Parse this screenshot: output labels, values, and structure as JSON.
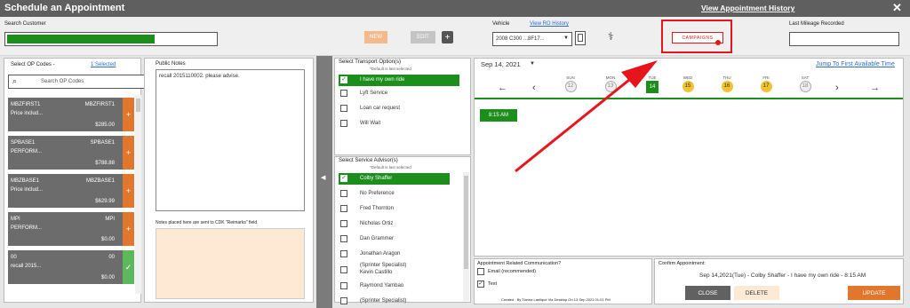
{
  "window": {
    "title": "Schedule an Appointment",
    "history_link": "View Appointment History",
    "close_glyph": "✕"
  },
  "topbar": {
    "search_label": "Search Customer",
    "new_label": "NEW",
    "edit_label": "EDIT",
    "vehicle_label": "Vehicle",
    "ro_history": "View RO History",
    "vehicle_value": "2008 C300 ...8F17...",
    "campaigns_label": "CAMPAIGNS",
    "mileage_label": "Last Mileage Recorded"
  },
  "op_codes": {
    "label": "Select OP Codes -",
    "selected_link": "1 Selected",
    "search_placeholder": "Search OP Codes",
    "items": [
      {
        "code": "MBZFIRST1",
        "code_right": "MBZFIRST1",
        "desc": "Price includ...",
        "price": "$285.00",
        "action": "+"
      },
      {
        "code": "SPBASE1",
        "code_right": "SPBASE1",
        "desc": "PERFORM...",
        "price": "$788.88",
        "action": "+"
      },
      {
        "code": "MBZBASE1",
        "code_right": "MBZBASE1",
        "desc": "Price includ...",
        "price": "$629.99",
        "action": "+"
      },
      {
        "code": "MPI",
        "code_right": "MPI",
        "desc": "PERFORM...",
        "price": "$0.00",
        "action": "+"
      },
      {
        "code": "00",
        "code_right": "00",
        "desc": "recall 2015...",
        "price": "$0.00",
        "action": "✓"
      }
    ]
  },
  "notes": {
    "public_label": "Public Notes",
    "public_text": "recall 2015110002. please advise.",
    "cdk_label": "Notes placed here are sent to CDK \"Reimarks\" field"
  },
  "transport": {
    "label": "Select Transport Option(s)",
    "sub": "*Default is last selected",
    "options": [
      "I have my own ride",
      "Lyft Service",
      "Loan car request",
      "Will Wait"
    ]
  },
  "advisor": {
    "label": "Select Service Advisor(s)",
    "sub": "*Default is last selected",
    "options": [
      "Colby Shaffer",
      "No Preference",
      "Fred Thornton",
      "Nicholas Ortiz",
      "Dan Grammer",
      "Jonathan Aragon",
      "(Sprinter Specialist)",
      "Kevin Castillo",
      "Raymond Yambao",
      "(Sprinter Specialist)"
    ]
  },
  "calendar": {
    "date": "Sep 14, 2021",
    "jump_link": "Jump To First Available Time",
    "days": [
      {
        "name": "SUN",
        "num": "12"
      },
      {
        "name": "MON",
        "num": "13"
      },
      {
        "name": "TUE",
        "num": "14"
      },
      {
        "name": "WED",
        "num": "15"
      },
      {
        "name": "THU",
        "num": "16"
      },
      {
        "name": "FRI",
        "num": "17"
      },
      {
        "name": "SAT",
        "num": "18"
      }
    ],
    "slot": "8:15 AM"
  },
  "communication": {
    "label": "Appointment Related Communication?",
    "email": "Email (recommended)",
    "text": "Text",
    "created": "Created : By Tianna Lastique Via Desktop On 13 Sep 2021 01:01 PM"
  },
  "confirm": {
    "label": "Confirm Appointment:",
    "summary": "Sep 14,2021(Tue) - Colby Shaffer - I have my own ride - 8:15 AM",
    "close": "CLOSE",
    "delete": "DELETE",
    "update": "UPDATE"
  },
  "colors": {
    "accent_green": "#1b8e1b",
    "orange": "#e1762d",
    "highlight_red": "#e8141b"
  }
}
